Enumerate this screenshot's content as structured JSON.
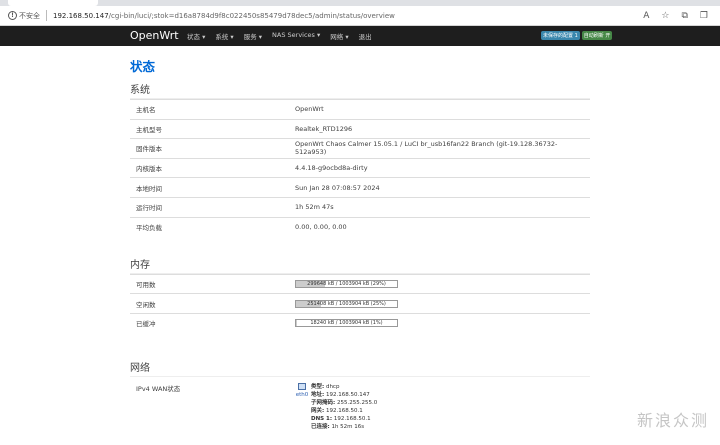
{
  "browser": {
    "security_label": "不安全",
    "url_host": "192.168.50.147",
    "url_path": "/cgi-bin/luci/;stok=d16a8784d9f8c022450s85479d78dec5/admin/status/overview",
    "tool_icons": [
      "reader-icon",
      "favorite-icon",
      "collections-icon",
      "extensions-icon"
    ]
  },
  "header": {
    "brand": "OpenWrt",
    "nav": [
      "状态 ▾",
      "系统 ▾",
      "服务 ▾",
      "NAS Services ▾",
      "网络 ▾",
      "退出"
    ],
    "badges": [
      "未保存的配置 1",
      "自动刷新 开"
    ]
  },
  "page_title": "状态",
  "system": {
    "title": "系统",
    "rows": [
      {
        "key": "主机名",
        "value": "OpenWrt"
      },
      {
        "key": "主机型号",
        "value": "Realtek_RTD1296"
      },
      {
        "key": "固件版本",
        "value": "OpenWrt Chaos Calmer 15.05.1 / LuCI br_usb16fan22 Branch (git-19.128.36732-512a953)"
      },
      {
        "key": "内核版本",
        "value": "4.4.18-g9ocbd8a-dirty"
      },
      {
        "key": "本地时间",
        "value": "Sun Jan 28 07:08:57 2024"
      },
      {
        "key": "运行时间",
        "value": "1h 52m 47s"
      },
      {
        "key": "平均负载",
        "value": "0.00, 0.00, 0.00"
      }
    ]
  },
  "memory": {
    "title": "内存",
    "rows": [
      {
        "key": "可用数",
        "text": "299648 kB / 1003904 kB (29%)",
        "fraction": 0.29
      },
      {
        "key": "空闲数",
        "text": "251408 kB / 1003904 kB (25%)",
        "fraction": 0.25
      },
      {
        "key": "已缓冲",
        "text": "18240 kB / 1003904 kB (1%)",
        "fraction": 0.01
      }
    ]
  },
  "network": {
    "title": "网络",
    "wan_label": "IPv4 WAN状态",
    "iface": "eth0",
    "details": [
      {
        "label": "类型:",
        "value": "dhcp"
      },
      {
        "label": "地址:",
        "value": "192.168.50.147"
      },
      {
        "label": "子网掩码:",
        "value": "255.255.255.0"
      },
      {
        "label": "网关:",
        "value": "192.168.50.1"
      },
      {
        "label": "DNS 1:",
        "value": "192.168.50.1"
      },
      {
        "label": "已连接:",
        "value": "1h 52m 16s"
      }
    ]
  },
  "watermark": "新浪众测"
}
